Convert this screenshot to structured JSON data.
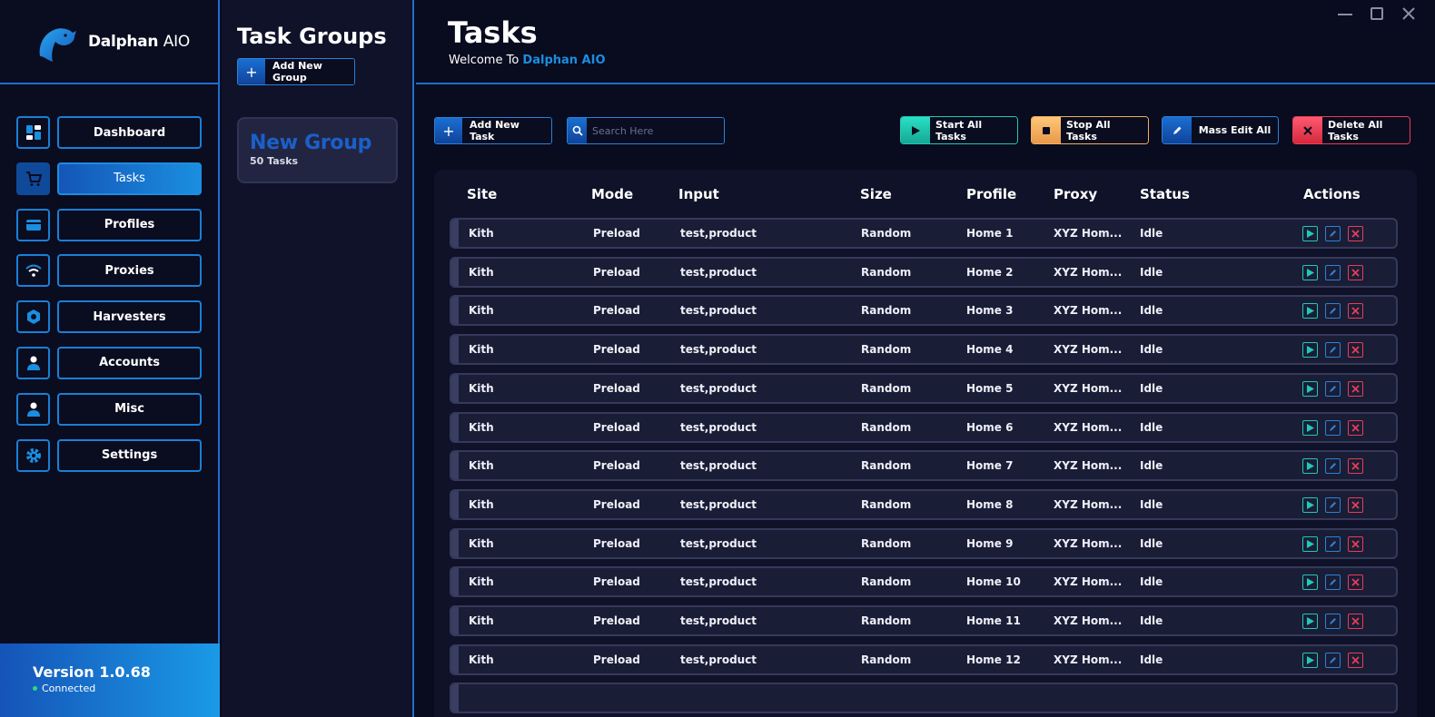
{
  "brand": {
    "name_bold": "Dalphan",
    "name_thin": "AIO"
  },
  "nav": [
    {
      "label": "Dashboard",
      "icon": "dashboard-icon",
      "active": false
    },
    {
      "label": "Tasks",
      "icon": "cart-icon",
      "active": true
    },
    {
      "label": "Profiles",
      "icon": "card-icon",
      "active": false
    },
    {
      "label": "Proxies",
      "icon": "wifi-icon",
      "active": false
    },
    {
      "label": "Harvesters",
      "icon": "hexagon-icon",
      "active": false
    },
    {
      "label": "Accounts",
      "icon": "user-icon",
      "active": false
    },
    {
      "label": "Misc",
      "icon": "user-icon",
      "active": false
    },
    {
      "label": "Settings",
      "icon": "gear-icon",
      "active": false
    }
  ],
  "footer": {
    "version": "Version 1.0.68",
    "status": "Connected"
  },
  "groups": {
    "title": "Task Groups",
    "add_label": "Add New Group",
    "items": [
      {
        "name": "New Group",
        "count": "50 Tasks"
      }
    ]
  },
  "main": {
    "title": "Tasks",
    "welcome_prefix": "Welcome To ",
    "welcome_accent": "Dalphan AIO",
    "add_task_label": "Add New Task",
    "search_placeholder": "Search Here",
    "start_all_label": "Start All Tasks",
    "stop_all_label": "Stop All Tasks",
    "mass_edit_label": "Mass Edit All",
    "delete_all_label": "Delete All Tasks"
  },
  "table": {
    "headers": [
      "Site",
      "Mode",
      "Input",
      "Size",
      "Profile",
      "Proxy",
      "Status",
      "Actions"
    ],
    "rows": [
      {
        "site": "Kith",
        "mode": "Preload",
        "input": "test,product",
        "size": "Random",
        "profile": "Home 1",
        "proxy": "XYZ Hom...",
        "status": "Idle"
      },
      {
        "site": "Kith",
        "mode": "Preload",
        "input": "test,product",
        "size": "Random",
        "profile": "Home 2",
        "proxy": "XYZ Hom...",
        "status": "Idle"
      },
      {
        "site": "Kith",
        "mode": "Preload",
        "input": "test,product",
        "size": "Random",
        "profile": "Home 3",
        "proxy": "XYZ Hom...",
        "status": "Idle"
      },
      {
        "site": "Kith",
        "mode": "Preload",
        "input": "test,product",
        "size": "Random",
        "profile": "Home 4",
        "proxy": "XYZ Hom...",
        "status": "Idle"
      },
      {
        "site": "Kith",
        "mode": "Preload",
        "input": "test,product",
        "size": "Random",
        "profile": "Home 5",
        "proxy": "XYZ Hom...",
        "status": "Idle"
      },
      {
        "site": "Kith",
        "mode": "Preload",
        "input": "test,product",
        "size": "Random",
        "profile": "Home 6",
        "proxy": "XYZ Hom...",
        "status": "Idle"
      },
      {
        "site": "Kith",
        "mode": "Preload",
        "input": "test,product",
        "size": "Random",
        "profile": "Home 7",
        "proxy": "XYZ Hom...",
        "status": "Idle"
      },
      {
        "site": "Kith",
        "mode": "Preload",
        "input": "test,product",
        "size": "Random",
        "profile": "Home 8",
        "proxy": "XYZ Hom...",
        "status": "Idle"
      },
      {
        "site": "Kith",
        "mode": "Preload",
        "input": "test,product",
        "size": "Random",
        "profile": "Home 9",
        "proxy": "XYZ Hom...",
        "status": "Idle"
      },
      {
        "site": "Kith",
        "mode": "Preload",
        "input": "test,product",
        "size": "Random",
        "profile": "Home 10",
        "proxy": "XYZ Hom...",
        "status": "Idle"
      },
      {
        "site": "Kith",
        "mode": "Preload",
        "input": "test,product",
        "size": "Random",
        "profile": "Home 11",
        "proxy": "XYZ Hom...",
        "status": "Idle"
      },
      {
        "site": "Kith",
        "mode": "Preload",
        "input": "test,product",
        "size": "Random",
        "profile": "Home 12",
        "proxy": "XYZ Hom...",
        "status": "Idle"
      },
      {
        "site": "",
        "mode": "",
        "input": "",
        "size": "",
        "profile": "",
        "proxy": "",
        "status": ""
      }
    ]
  },
  "colors": {
    "accent": "#1a8ee0",
    "start": "#21c8b6",
    "stop": "#f0b060",
    "delete": "#e83d56",
    "bg": "#090b1e"
  }
}
